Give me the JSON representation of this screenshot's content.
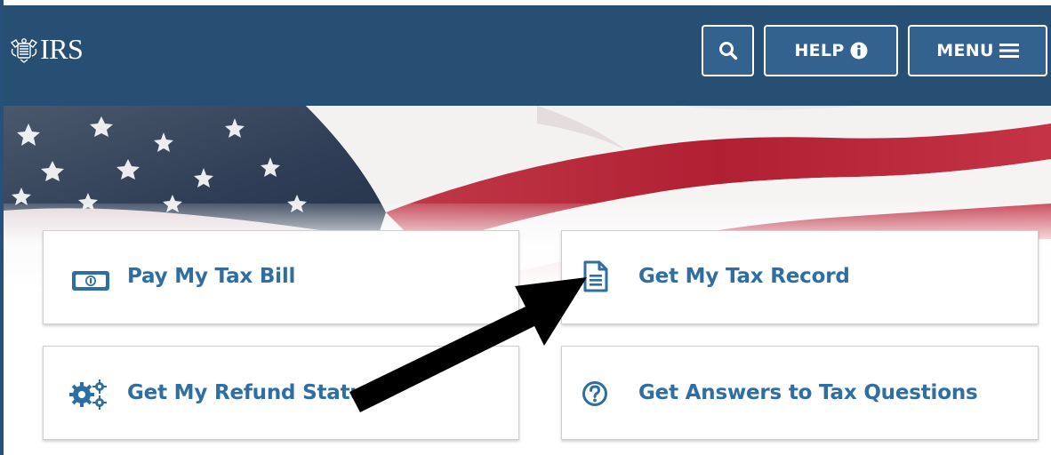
{
  "header": {
    "logo_text": "IRS",
    "search_icon": "search-icon",
    "help_label": "HELP",
    "help_icon": "info-circle-icon",
    "menu_label": "MENU",
    "menu_icon": "hamburger-icon"
  },
  "hero": {
    "image": "american-flag-banner"
  },
  "cards": {
    "pay": {
      "label": "Pay My Tax Bill",
      "icon": "money-bill-icon"
    },
    "record": {
      "label": "Get My Tax Record",
      "icon": "document-icon"
    },
    "refund": {
      "label": "Get My Refund Status",
      "icon": "gears-icon"
    },
    "answers": {
      "label": "Get Answers to Tax Questions",
      "icon": "question-circle-icon"
    }
  },
  "annotation": {
    "icon": "pointer-arrow"
  },
  "colors": {
    "header_bg": "#274f73",
    "button_bg": "#33628f",
    "link_blue": "#2e6ea3",
    "flag_red": "#b5253b"
  }
}
